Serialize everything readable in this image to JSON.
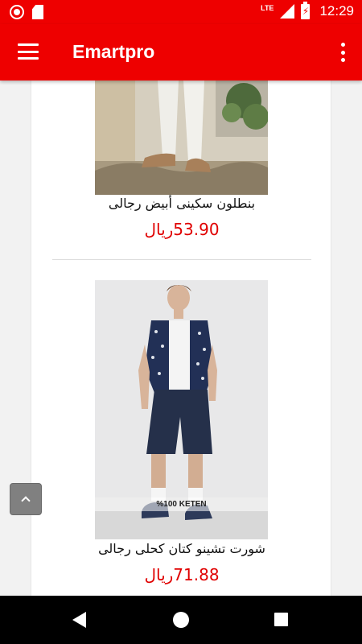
{
  "status_bar": {
    "network": "LTE",
    "time": "12:29"
  },
  "app_bar": {
    "title": "Emartpro"
  },
  "products": [
    {
      "name": "بنطلون سكينى أبيض رجالى",
      "price": "53.90ريال",
      "image_icon": "white-skinny-pants-photo"
    },
    {
      "name": "شورت تشينو كتان كحلى رجالى",
      "price": "71.88ريال",
      "image_icon": "navy-chino-shorts-photo",
      "image_caption": "%100 KETEN"
    }
  ],
  "colors": {
    "primary": "#ee0000",
    "price": "#e00000"
  }
}
